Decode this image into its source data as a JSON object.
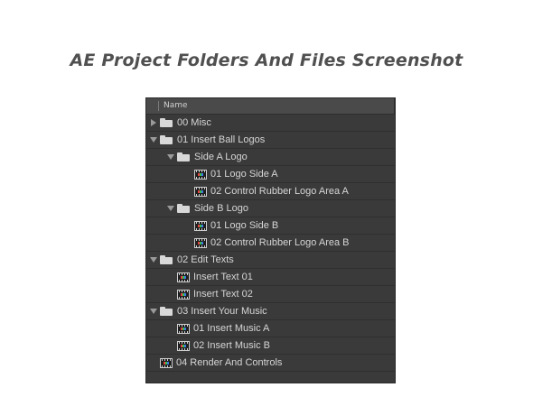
{
  "page": {
    "title": "AE Project Folders And Files Screenshot"
  },
  "panel": {
    "column_header": "Name",
    "rows": [
      {
        "label": "00 Misc",
        "type": "folder",
        "expanded": false,
        "depth": 0
      },
      {
        "label": "01 Insert Ball Logos",
        "type": "folder",
        "expanded": true,
        "depth": 0
      },
      {
        "label": "Side A Logo",
        "type": "folder",
        "expanded": true,
        "depth": 1
      },
      {
        "label": "01 Logo Side A",
        "type": "composition",
        "depth": 2
      },
      {
        "label": "02 Control Rubber Logo Area A",
        "type": "composition",
        "depth": 2
      },
      {
        "label": "Side B Logo",
        "type": "folder",
        "expanded": true,
        "depth": 1
      },
      {
        "label": "01 Logo Side B",
        "type": "composition",
        "depth": 2
      },
      {
        "label": "02 Control Rubber Logo Area B",
        "type": "composition",
        "depth": 2
      },
      {
        "label": "02 Edit Texts",
        "type": "folder",
        "expanded": true,
        "depth": 0
      },
      {
        "label": "Insert Text 01",
        "type": "composition",
        "depth": 1
      },
      {
        "label": "Insert Text 02",
        "type": "composition",
        "depth": 1
      },
      {
        "label": "03 Insert Your Music",
        "type": "folder",
        "expanded": true,
        "depth": 0
      },
      {
        "label": "01 Insert Music A",
        "type": "composition",
        "depth": 1
      },
      {
        "label": "02 Insert Music B",
        "type": "composition",
        "depth": 1
      },
      {
        "label": "04 Render And Controls",
        "type": "composition",
        "depth": 0
      }
    ]
  },
  "colors": {
    "panel_bg": "#3a3a3a",
    "header_bg": "#4a4a4a",
    "row_divider": "#2f2f2f",
    "text": "#d6d6d6",
    "folder": "#d8d8d8",
    "title": "#505050"
  }
}
